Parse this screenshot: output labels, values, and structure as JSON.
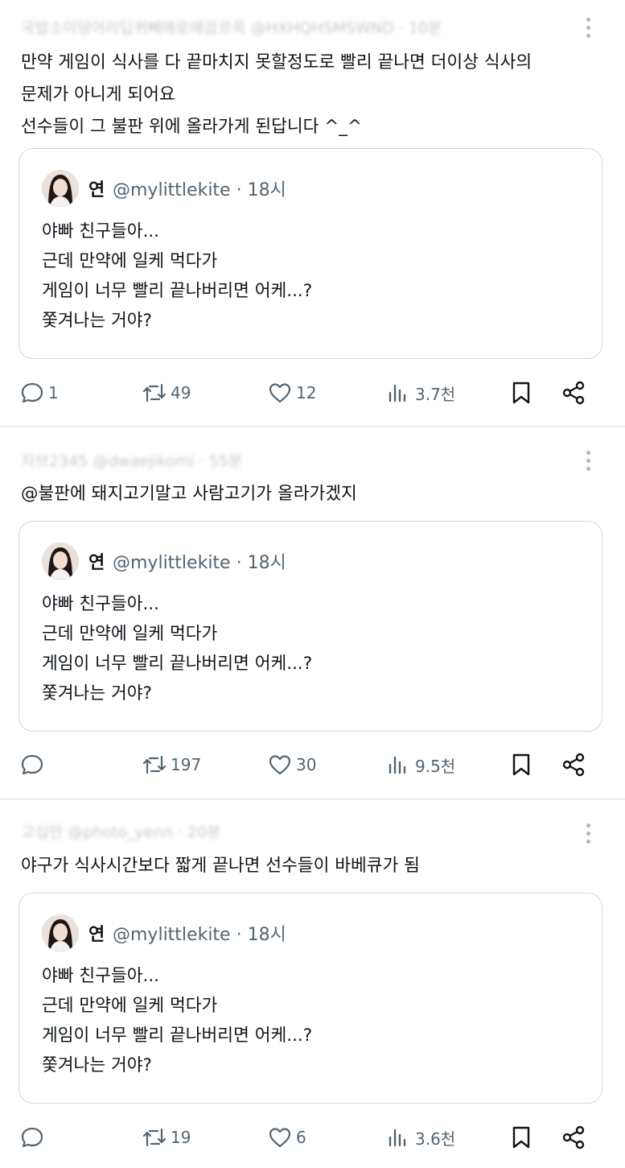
{
  "tweets": [
    {
      "header": "국밥소이덩어리딥퀴빼애로애끕르윽 @HXHQHSMSWND · 10분",
      "text_lines": [
        "만약 게임이 식사를 다 끝마치지 못할정도로 빨리 끝나면 더이상 식사의",
        "문제가 아니게 되어요",
        "선수들이 그 불판 위에 올라가게 된답니다 ^_^"
      ],
      "quote": {
        "name": "연",
        "handle_time": "@mylittlekite · 18시",
        "lines": [
          "야빠 친구들아...",
          "근데 만약에 일케 먹다가",
          "게임이 너무 빨리 끝나버리면 어케...?",
          "쫓겨나는 거야?"
        ]
      },
      "actions": {
        "replies": "1",
        "retweets": "49",
        "likes": "12",
        "views": "3.7천"
      }
    },
    {
      "header": "자브2345 @dwaejikomi · 55분",
      "text_lines": [
        "@불판에 돼지고기말고 사람고기가 올라가겠지"
      ],
      "quote": {
        "name": "연",
        "handle_time": "@mylittlekite · 18시",
        "lines": [
          "야빠 친구들아...",
          "근데 만약에 일케 먹다가",
          "게임이 너무 빨리 끝나버리면 어케...?",
          "쫓겨나는 거야?"
        ]
      },
      "actions": {
        "replies": "",
        "retweets": "197",
        "likes": "30",
        "views": "9.5천"
      }
    },
    {
      "header": "고십만 @photo_yenn · 20분",
      "text_lines": [
        "야구가 식사시간보다 짧게 끝나면 선수들이 바베큐가 됨"
      ],
      "quote": {
        "name": "연",
        "handle_time": "@mylittlekite · 18시",
        "lines": [
          "야빠 친구들아...",
          "근데 만약에 일케 먹다가",
          "게임이 너무 빨리 끝나버리면 어케...?",
          "쫓겨나는 거야?"
        ]
      },
      "actions": {
        "replies": "",
        "retweets": "19",
        "likes": "6",
        "views": "3.6천"
      }
    }
  ],
  "icons": {
    "reply": "speech-bubble-icon",
    "retweet": "retweet-arrows-icon",
    "like": "heart-icon",
    "views": "bar-chart-icon",
    "bookmark": "bookmark-icon",
    "share": "share-icon",
    "more": "vertical-dots-icon"
  },
  "colors": {
    "text": "#0f1419",
    "muted": "#536471",
    "border": "#cfd9de"
  }
}
